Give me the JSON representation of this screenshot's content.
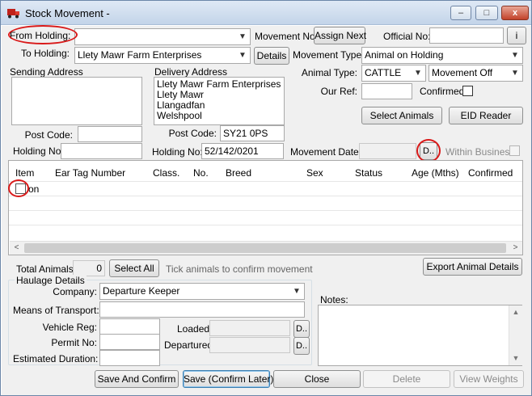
{
  "window": {
    "title": "Stock Movement -",
    "controls": [
      "–",
      "□",
      "x"
    ]
  },
  "header": {
    "from_holding_label": "From Holding:",
    "from_holding_value": "",
    "to_holding_label": "To Holding:",
    "to_holding_value": "Llety Mawr Farm Enterprises",
    "details_button": "Details",
    "movement_no_label": "Movement No:",
    "assign_next_button": "Assign Next",
    "official_no_label": "Official No:",
    "official_no_value": "",
    "info_button": "i",
    "movement_type_label": "Movement Type:",
    "movement_type_value": "Animal on Holding",
    "animal_type_label": "Animal Type:",
    "animal_type_value": "CATTLE",
    "movement_direction_value": "Movement Off",
    "our_ref_label": "Our Ref:",
    "our_ref_value": "",
    "confirmed_label": "Confirmed:",
    "select_animals_button": "Select Animals",
    "eid_reader_button": "EID Reader",
    "movement_date_label": "Movement Date:",
    "movement_date_value": "",
    "date_picker_button": "D..",
    "within_business_label": "Within Business"
  },
  "sending": {
    "address_label": "Sending Address",
    "address_lines": [
      "",
      "",
      "",
      ""
    ],
    "post_code_label": "Post Code:",
    "post_code_value": "",
    "holding_no_label": "Holding No:",
    "holding_no_value": ""
  },
  "delivery": {
    "address_label": "Delivery Address",
    "address_lines": [
      "Llety Mawr Farm Enterprises",
      "Llety Mawr",
      "Llangadfan",
      "Welshpool"
    ],
    "post_code_label": "Post Code:",
    "post_code_value": "SY21 0PS",
    "holding_no_label": "Holding No:",
    "holding_no_value": "52/142/0201"
  },
  "grid": {
    "columns": [
      "Item",
      "Ear Tag Number",
      "Class.",
      "No.",
      "Breed",
      "Sex",
      "Status",
      "Age (Mths)",
      "Confirmed"
    ],
    "first_row_item": "on",
    "scroll_left": "<",
    "scroll_right": ">"
  },
  "summary": {
    "total_animals_label": "Total Animals:",
    "total_animals_value": "0",
    "select_all_button": "Select All",
    "tick_hint": "Tick animals to confirm movement",
    "export_button": "Export Animal Details"
  },
  "haulage": {
    "group_label": "Haulage Details",
    "company_label": "Company:",
    "company_value": "Departure Keeper",
    "transport_label": "Means of Transport:",
    "transport_value": "",
    "vehicle_reg_label": "Vehicle Reg:",
    "vehicle_reg_value": "",
    "permit_no_label": "Permit No:",
    "permit_no_value": "",
    "duration_label": "Estimated Duration:",
    "duration_value": "",
    "loaded_label": "Loaded:",
    "loaded_value": "",
    "loaded_button": "D..",
    "departured_label": "Departured:",
    "departured_value": "",
    "departured_button": "D.."
  },
  "notes": {
    "label": "Notes:",
    "value": ""
  },
  "footer": {
    "save_confirm": "Save And Confirm",
    "save_confirm_later": "Save (Confirm Later)",
    "close": "Close",
    "delete": "Delete",
    "view_weights": "View Weights"
  },
  "colors": {
    "annotation": "#d91919",
    "window_bg": "#f0f0f0",
    "focus_border": "#3c7fb1"
  }
}
